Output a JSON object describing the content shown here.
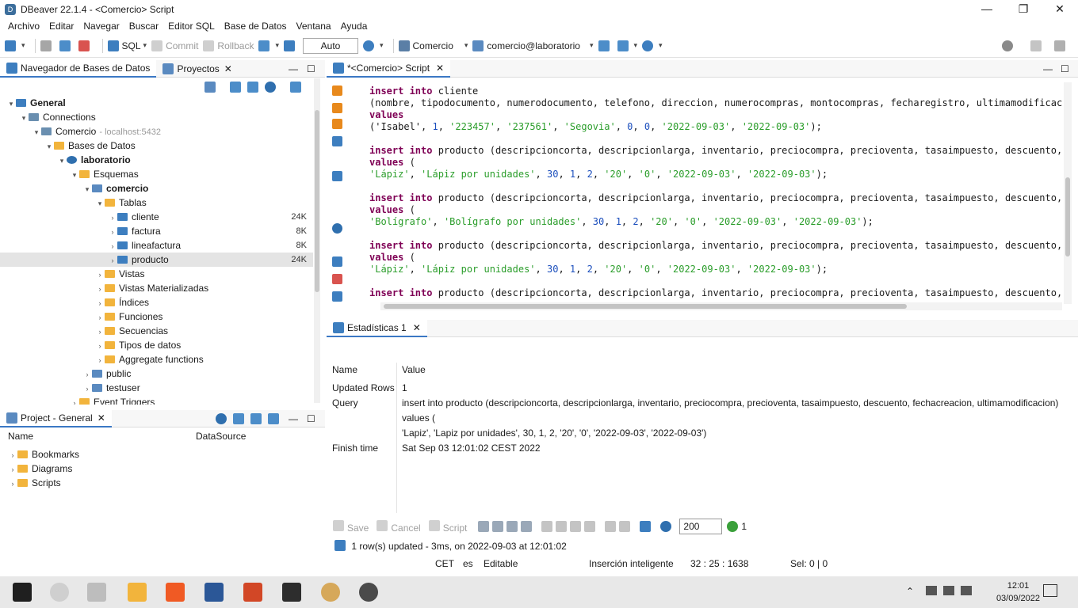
{
  "window": {
    "title": "DBeaver 22.1.4 - <Comercio> Script",
    "minimize": "—",
    "maximize": "❐",
    "close": "✕"
  },
  "menu": [
    "Archivo",
    "Editar",
    "Navegar",
    "Buscar",
    "Editor SQL",
    "Base de Datos",
    "Ventana",
    "Ayuda"
  ],
  "toolbar": {
    "sql_label": "SQL",
    "commit_label": "Commit",
    "rollback_label": "Rollback",
    "mode_value": "Auto",
    "datasource_label": "Comercio",
    "schema_label": "comercio@laboratorio"
  },
  "navigator": {
    "tab_label": "Navegador de Bases de Datos",
    "projects_tab_label": "Proyectos",
    "tree": [
      {
        "label": "General",
        "bold": true,
        "icon": "project-icon",
        "indent": 0,
        "toggle": "▾"
      },
      {
        "label": "Connections",
        "indent": 1,
        "icon": "connections-icon",
        "toggle": "▾"
      },
      {
        "label": "Comercio",
        "note": "- localhost:5432",
        "indent": 2,
        "icon": "postgres-icon",
        "toggle": "▾"
      },
      {
        "label": "Bases de Datos",
        "indent": 3,
        "icon": "folder-icon",
        "toggle": "▾"
      },
      {
        "label": "laboratorio",
        "bold": true,
        "indent": 4,
        "icon": "database-icon",
        "toggle": "▾"
      },
      {
        "label": "Esquemas",
        "indent": 5,
        "icon": "folder-icon",
        "toggle": "▾"
      },
      {
        "label": "comercio",
        "bold": true,
        "indent": 6,
        "icon": "schema-icon",
        "toggle": "▾"
      },
      {
        "label": "Tablas",
        "indent": 7,
        "icon": "folder-icon",
        "toggle": "▾"
      },
      {
        "label": "cliente",
        "indent": 8,
        "icon": "table-icon",
        "toggle": "›",
        "size": "24K"
      },
      {
        "label": "factura",
        "indent": 8,
        "icon": "table-icon",
        "toggle": "›",
        "size": "8K"
      },
      {
        "label": "lineafactura",
        "indent": 8,
        "icon": "table-icon",
        "toggle": "›",
        "size": "8K"
      },
      {
        "label": "producto",
        "indent": 8,
        "icon": "table-icon",
        "toggle": "›",
        "size": "24K",
        "selected": true
      },
      {
        "label": "Vistas",
        "indent": 7,
        "icon": "folder-icon",
        "toggle": "›"
      },
      {
        "label": "Vistas Materializadas",
        "indent": 7,
        "icon": "folder-icon",
        "toggle": "›"
      },
      {
        "label": "Índices",
        "indent": 7,
        "icon": "folder-icon",
        "toggle": "›"
      },
      {
        "label": "Funciones",
        "indent": 7,
        "icon": "folder-icon",
        "toggle": "›"
      },
      {
        "label": "Secuencias",
        "indent": 7,
        "icon": "folder-icon",
        "toggle": "›"
      },
      {
        "label": "Tipos de datos",
        "indent": 7,
        "icon": "folder-icon",
        "toggle": "›"
      },
      {
        "label": "Aggregate functions",
        "indent": 7,
        "icon": "folder-icon",
        "toggle": "›"
      },
      {
        "label": "public",
        "indent": 6,
        "icon": "schema-icon",
        "toggle": "›"
      },
      {
        "label": "testuser",
        "indent": 6,
        "icon": "schema-icon",
        "toggle": "›"
      },
      {
        "label": "Event Triggers",
        "indent": 5,
        "icon": "folder-icon",
        "toggle": "›"
      }
    ]
  },
  "project": {
    "tab_label": "Project - General",
    "col_name": "Name",
    "col_datasource": "DataSource",
    "items": [
      "Bookmarks",
      "Diagrams",
      "Scripts"
    ]
  },
  "editor": {
    "tab_label": "*<Comercio> Script",
    "lines": [
      [
        {
          "t": "insert into ",
          "c": "kw"
        },
        {
          "t": "cliente",
          "c": ""
        }
      ],
      [
        {
          "t": "(nombre, tipodocumento, numerodocumento, telefono, direccion, numerocompras, montocompras, fecharegistro, ultimamodificacion)",
          "c": ""
        }
      ],
      [
        {
          "t": "values",
          "c": "kw"
        }
      ],
      [
        {
          "t": "('Isabel', ",
          "c": ""
        },
        {
          "t": "1",
          "c": "num"
        },
        {
          "t": ", ",
          "c": ""
        },
        {
          "t": "'223457'",
          "c": "str"
        },
        {
          "t": ", ",
          "c": ""
        },
        {
          "t": "'237561'",
          "c": "str"
        },
        {
          "t": ", ",
          "c": ""
        },
        {
          "t": "'Segovia'",
          "c": "str"
        },
        {
          "t": ", ",
          "c": ""
        },
        {
          "t": "0",
          "c": "num"
        },
        {
          "t": ", ",
          "c": ""
        },
        {
          "t": "0",
          "c": "num"
        },
        {
          "t": ", ",
          "c": ""
        },
        {
          "t": "'2022-09-03'",
          "c": "str"
        },
        {
          "t": ", ",
          "c": ""
        },
        {
          "t": "'2022-09-03'",
          "c": "str"
        },
        {
          "t": ");",
          "c": ""
        }
      ],
      [],
      [
        {
          "t": "insert into ",
          "c": "kw"
        },
        {
          "t": "producto (descripcioncorta, descripcionlarga, inventario, preciocompra, precioventa, tasaimpuesto, descuento, f",
          "c": ""
        }
      ],
      [
        {
          "t": "values",
          "c": "kw"
        },
        {
          "t": " (",
          "c": ""
        }
      ],
      [
        {
          "t": "'Lápiz'",
          "c": "str"
        },
        {
          "t": ", ",
          "c": ""
        },
        {
          "t": "'Lápiz por unidades'",
          "c": "str"
        },
        {
          "t": ", ",
          "c": ""
        },
        {
          "t": "30",
          "c": "num"
        },
        {
          "t": ", ",
          "c": ""
        },
        {
          "t": "1",
          "c": "num"
        },
        {
          "t": ", ",
          "c": ""
        },
        {
          "t": "2",
          "c": "num"
        },
        {
          "t": ", ",
          "c": ""
        },
        {
          "t": "'20'",
          "c": "str"
        },
        {
          "t": ", ",
          "c": ""
        },
        {
          "t": "'0'",
          "c": "str"
        },
        {
          "t": ", ",
          "c": ""
        },
        {
          "t": "'2022-09-03'",
          "c": "str"
        },
        {
          "t": ", ",
          "c": ""
        },
        {
          "t": "'2022-09-03'",
          "c": "str"
        },
        {
          "t": ");",
          "c": ""
        }
      ],
      [],
      [
        {
          "t": "insert into ",
          "c": "kw"
        },
        {
          "t": "producto (descripcioncorta, descripcionlarga, inventario, preciocompra, precioventa, tasaimpuesto, descuento, f",
          "c": ""
        }
      ],
      [
        {
          "t": "values",
          "c": "kw"
        },
        {
          "t": " (",
          "c": ""
        }
      ],
      [
        {
          "t": "'Bolígrafo'",
          "c": "str"
        },
        {
          "t": ", ",
          "c": ""
        },
        {
          "t": "'Bolígrafo por unidades'",
          "c": "str"
        },
        {
          "t": ", ",
          "c": ""
        },
        {
          "t": "30",
          "c": "num"
        },
        {
          "t": ", ",
          "c": ""
        },
        {
          "t": "1",
          "c": "num"
        },
        {
          "t": ", ",
          "c": ""
        },
        {
          "t": "2",
          "c": "num"
        },
        {
          "t": ", ",
          "c": ""
        },
        {
          "t": "'20'",
          "c": "str"
        },
        {
          "t": ", ",
          "c": ""
        },
        {
          "t": "'0'",
          "c": "str"
        },
        {
          "t": ", ",
          "c": ""
        },
        {
          "t": "'2022-09-03'",
          "c": "str"
        },
        {
          "t": ", ",
          "c": ""
        },
        {
          "t": "'2022-09-03'",
          "c": "str"
        },
        {
          "t": ");",
          "c": ""
        }
      ],
      [],
      [
        {
          "t": "insert into ",
          "c": "kw"
        },
        {
          "t": "producto (descripcioncorta, descripcionlarga, inventario, preciocompra, precioventa, tasaimpuesto, descuento, f",
          "c": ""
        }
      ],
      [
        {
          "t": "values",
          "c": "kw"
        },
        {
          "t": " (",
          "c": ""
        }
      ],
      [
        {
          "t": "'Lápiz'",
          "c": "str"
        },
        {
          "t": ", ",
          "c": ""
        },
        {
          "t": "'Lápiz por unidades'",
          "c": "str"
        },
        {
          "t": ", ",
          "c": ""
        },
        {
          "t": "30",
          "c": "num"
        },
        {
          "t": ", ",
          "c": ""
        },
        {
          "t": "1",
          "c": "num"
        },
        {
          "t": ", ",
          "c": ""
        },
        {
          "t": "2",
          "c": "num"
        },
        {
          "t": ", ",
          "c": ""
        },
        {
          "t": "'20'",
          "c": "str"
        },
        {
          "t": ", ",
          "c": ""
        },
        {
          "t": "'0'",
          "c": "str"
        },
        {
          "t": ", ",
          "c": ""
        },
        {
          "t": "'2022-09-03'",
          "c": "str"
        },
        {
          "t": ", ",
          "c": ""
        },
        {
          "t": "'2022-09-03'",
          "c": "str"
        },
        {
          "t": ");",
          "c": ""
        }
      ],
      [],
      [
        {
          "t": "insert into ",
          "c": "kw"
        },
        {
          "t": "producto (descripcioncorta, descripcionlarga, inventario, preciocompra, precioventa, tasaimpuesto, descuento, f",
          "c": ""
        }
      ]
    ]
  },
  "results": {
    "tab_label": "Estadísticas 1",
    "col_name": "Name",
    "col_value": "Value",
    "rows": [
      {
        "k": "Updated Rows",
        "v": [
          "1"
        ]
      },
      {
        "k": "Query",
        "v": [
          "insert into producto (descripcioncorta, descripcionlarga, inventario, preciocompra, precioventa, tasaimpuesto, descuento, fechacreacion, ultimamodificacion)",
          "values (",
          "'Lapiz', 'Lapiz por unidades', 30, 1, 2, '20', '0', '2022-09-03', '2022-09-03')"
        ]
      },
      {
        "k": "Finish time",
        "v": [
          "Sat Sep 03 12:01:02 CEST 2022"
        ]
      }
    ],
    "toolbar": {
      "save": "Save",
      "cancel": "Cancel",
      "script": "Script",
      "limit": "200",
      "refresh_count": "1"
    },
    "status": "1 row(s) updated - 3ms, on 2022-09-03 at 12:01:02"
  },
  "statusbar": {
    "tz": "CET",
    "lang": "es",
    "mode": "Editable",
    "insert": "Inserción inteligente",
    "pos": "32 : 25 : 1638",
    "sel": "Sel: 0 | 0"
  },
  "taskbar": {
    "time": "12:01",
    "date": "03/09/2022"
  }
}
